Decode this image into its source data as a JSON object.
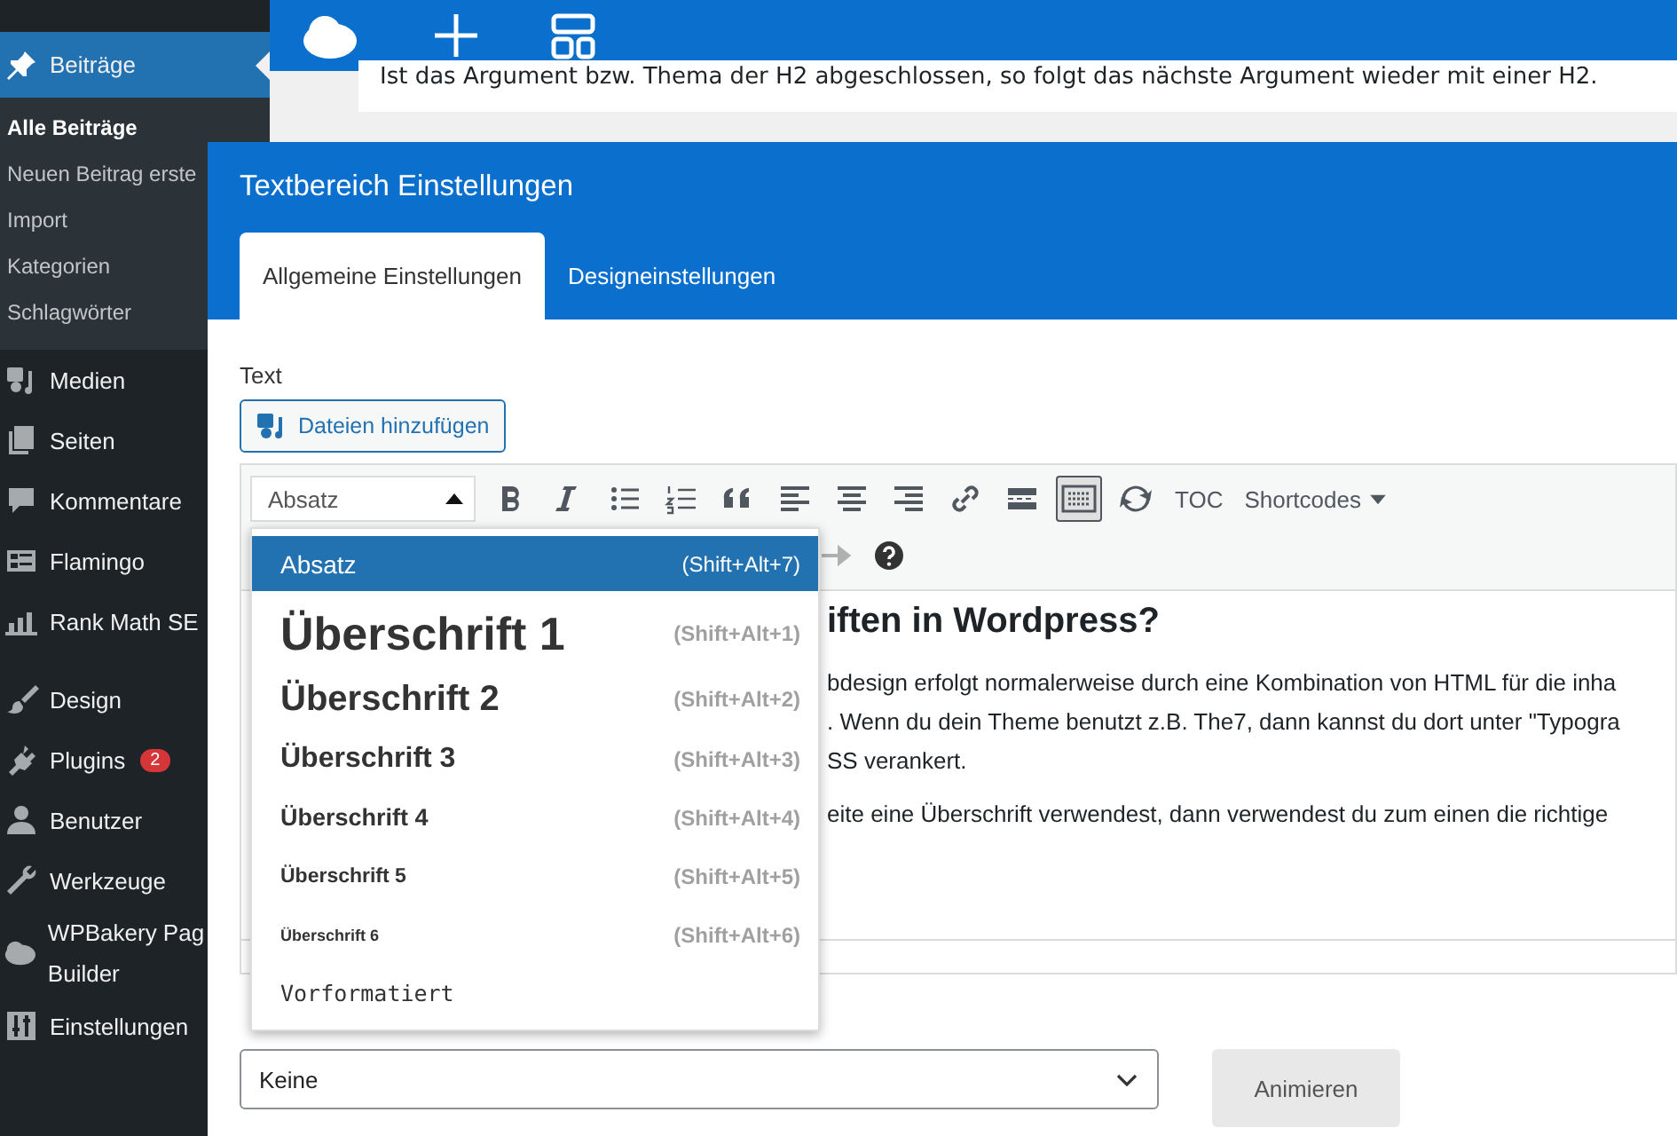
{
  "sidebar": {
    "items": [
      {
        "label": "Beiträge",
        "selected": true,
        "children": [
          {
            "label": "Alle Beiträge",
            "selected": true
          },
          {
            "label": "Neuen Beitrag erste",
            "selected": false
          },
          {
            "label": "Import",
            "selected": false
          },
          {
            "label": "Kategorien",
            "selected": false
          },
          {
            "label": "Schlagwörter",
            "selected": false
          }
        ]
      },
      {
        "label": "Medien",
        "selected": false
      },
      {
        "label": "Seiten",
        "selected": false
      },
      {
        "label": "Kommentare",
        "selected": false
      },
      {
        "label": "Flamingo",
        "selected": false
      },
      {
        "label": "Rank Math SE",
        "selected": false
      },
      {
        "label": "Design",
        "selected": false
      },
      {
        "label": "Plugins",
        "selected": false,
        "badge": "2"
      },
      {
        "label": "Benutzer",
        "selected": false
      },
      {
        "label": "Werkzeuge",
        "selected": false
      },
      {
        "label": "WPBakery Pag Builder",
        "selected": false
      },
      {
        "label": "Einstellungen",
        "selected": false
      }
    ]
  },
  "background_card": {
    "text": "Ist das Argument bzw. Thema der H2 abgeschlossen, so folgt das nächste Argument wieder mit einer H2."
  },
  "modal": {
    "title": "Textbereich Einstellungen",
    "tabs": [
      {
        "label": "Allgemeine Einstellungen",
        "selected": true
      },
      {
        "label": "Designeinstellungen",
        "selected": false
      }
    ],
    "text_label": "Text",
    "add_media_button": "Dateien hinzufügen",
    "format_select": {
      "value": "Absatz",
      "expanded": true
    },
    "toolbar": {
      "toggle_pressed": true,
      "toc": "TOC",
      "shortcodes": "Shortcodes"
    },
    "format_menu": [
      {
        "label": "Absatz",
        "shortcut": "(Shift+Alt+7)",
        "kind": "p",
        "selected": true
      },
      {
        "label": "Überschrift 1",
        "shortcut": "(Shift+Alt+1)",
        "kind": "h1",
        "selected": false
      },
      {
        "label": "Überschrift 2",
        "shortcut": "(Shift+Alt+2)",
        "kind": "h2",
        "selected": false
      },
      {
        "label": "Überschrift 3",
        "shortcut": "(Shift+Alt+3)",
        "kind": "h3",
        "selected": false
      },
      {
        "label": "Überschrift 4",
        "shortcut": "(Shift+Alt+4)",
        "kind": "h4",
        "selected": false
      },
      {
        "label": "Überschrift 5",
        "shortcut": "(Shift+Alt+5)",
        "kind": "h5",
        "selected": false
      },
      {
        "label": "Überschrift 6",
        "shortcut": "(Shift+Alt+6)",
        "kind": "h6",
        "selected": false
      },
      {
        "label": "Vorformatiert",
        "kind": "pre",
        "selected": false
      }
    ],
    "content": {
      "heading": "iften in Wordpress?",
      "paragraphs": [
        "bdesign erfolgt normalerweise durch eine Kombination von HTML für die inha",
        ". Wenn du dein Theme benutzt z.B. The7, dann kannst du dort unter \"Typogra",
        "SS verankert.",
        "eite eine Überschrift verwendest, dann verwendest du zum einen die richtige"
      ]
    },
    "css_animation": {
      "value": "Keine",
      "button": "Animieren"
    }
  }
}
